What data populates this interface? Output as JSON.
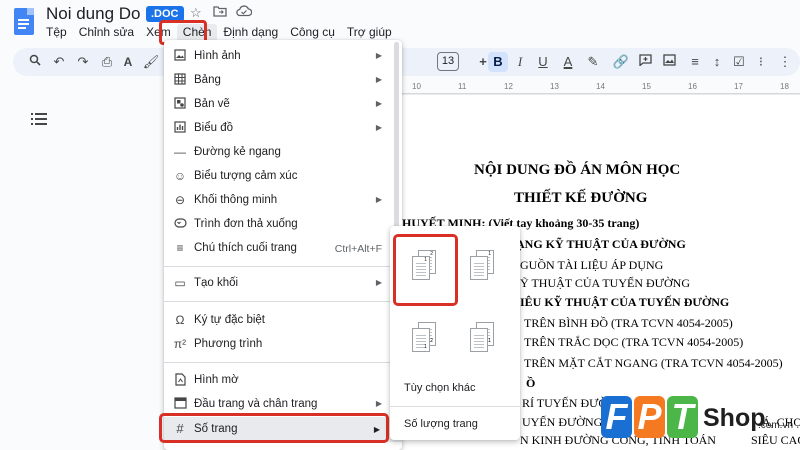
{
  "header": {
    "doc_title": "Noi dung Do an",
    "badge": ".DOC",
    "icons": [
      "star-icon",
      "move-to-folder-icon",
      "cloud-status-icon"
    ]
  },
  "menubar": [
    "Tệp",
    "Chỉnh sửa",
    "Xem",
    "Chèn",
    "Định dạng",
    "Công cụ",
    "Trợ giúp"
  ],
  "toolbar": {
    "font_size": "13",
    "bold": "B",
    "text_color": "A",
    "icons": [
      "search-icon",
      "undo-icon",
      "redo-icon",
      "print-icon",
      "spellcheck-icon",
      "paint-format-icon",
      "bold-icon",
      "text-color-icon",
      "highlight-icon",
      "link-icon",
      "comment-icon",
      "image-icon",
      "align-icon",
      "line-spacing-icon",
      "checklist-icon",
      "bulleted-list-icon",
      "numbered-list-icon",
      "more-icon"
    ]
  },
  "ruler": [
    "10",
    "11",
    "12",
    "13",
    "14",
    "15",
    "16",
    "17",
    "18"
  ],
  "insert_menu": {
    "items": [
      {
        "label": "Hình ảnh",
        "icon": "image-icon",
        "submenu": true
      },
      {
        "label": "Bảng",
        "icon": "table-icon",
        "submenu": true
      },
      {
        "label": "Bản vẽ",
        "icon": "drawing-icon",
        "submenu": true
      },
      {
        "label": "Biểu đồ",
        "icon": "chart-icon",
        "submenu": true
      },
      {
        "label": "Đường kẻ ngang",
        "icon": "horizontal-line-icon",
        "submenu": false
      },
      {
        "label": "Biểu tượng cảm xúc",
        "icon": "emoji-icon",
        "submenu": false
      },
      {
        "label": "Khối thông minh",
        "icon": "smart-chip-icon",
        "submenu": true
      },
      {
        "label": "Trình đơn thả xuống",
        "icon": "dropdown-icon",
        "submenu": false
      },
      {
        "label": "Chú thích cuối trang",
        "icon": "footnote-icon",
        "shortcut": "Ctrl+Alt+F"
      },
      {
        "label": "Tạo khối",
        "icon": "building-block-icon",
        "submenu": true
      },
      {
        "label": "Ký tự đặc biệt",
        "icon": "omega-icon",
        "submenu": false
      },
      {
        "label": "Phương trình",
        "icon": "equation-icon",
        "submenu": false
      },
      {
        "label": "Hình mờ",
        "icon": "watermark-icon",
        "submenu": false
      },
      {
        "label": "Đầu trang và chân trang",
        "icon": "header-footer-icon",
        "submenu": true
      },
      {
        "label": "Số trang",
        "icon": "hash-icon",
        "submenu": true
      }
    ]
  },
  "page_numbers_submenu": {
    "more_options": "Tùy chọn khác",
    "page_count": "Số lượng trang",
    "thumb_numbers": [
      "1",
      "2"
    ]
  },
  "document": {
    "lines": [
      "NỘI DUNG ĐỒ ÁN MÔN HỌC",
      "THIẾT KẾ ĐƯỜNG",
      "HUYẾT MINH: (Viết tay khoảng 30-35 trang)",
      "ẠNG KỸ THUẬT CỦA ĐƯỜNG",
      "GUỒN TÀI LIỆU ÁP DỤNG",
      "Ỹ THUẬT CỦA TUYẾN ĐƯỜNG",
      "IÊU KỸ THUẬT CỦA TUYẾN ĐƯỜNG",
      "TRÊN BÌNH ĐỒ (TRA TCVN 4054-2005)",
      "TRÊN TRẮC DỌC (TRA TCVN 4054-2005)",
      "TRÊN MẶT CẮT NGANG (TRA TCVN 4054-2005)",
      "Ồ",
      "RÍ TUYẾN ĐƯỜ",
      "UYẾN ĐƯỜNG",
      "N KINH ĐƯỜNG CONG, TÍNH TOÁN",
      "Á, CHỌ",
      "SIÊU CAO, ĐƯỜ"
    ]
  },
  "logo": {
    "letters": [
      "F",
      "P",
      "T"
    ],
    "shop": "Shop",
    "domain": ".com.vn"
  },
  "colors": {
    "highlight": "#d93025",
    "accent": "#1a73e8",
    "logo_blue": "#1a6fd2",
    "logo_orange": "#f47920",
    "logo_green": "#4cb748"
  }
}
